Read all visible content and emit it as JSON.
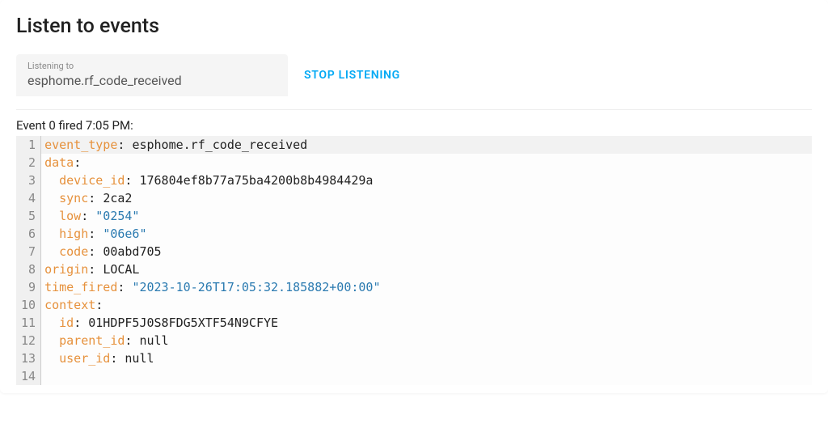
{
  "page": {
    "title": "Listen to events"
  },
  "input": {
    "label": "Listening to",
    "value": "esphome.rf_code_received"
  },
  "actions": {
    "stop": "Stop Listening"
  },
  "event_header": "Event 0 fired 7:05 PM:",
  "yaml": {
    "event_type_key": "event_type",
    "event_type_val": "esphome.rf_code_received",
    "data_key": "data",
    "device_id_key": "device_id",
    "device_id_val": "176804ef8b77a75ba4200b8b4984429a",
    "sync_key": "sync",
    "sync_val": "2ca2",
    "low_key": "low",
    "low_val": "\"0254\"",
    "high_key": "high",
    "high_val": "\"06e6\"",
    "code_key": "code",
    "code_val": "00abd705",
    "origin_key": "origin",
    "origin_val": "LOCAL",
    "time_fired_key": "time_fired",
    "time_fired_val": "\"2023-10-26T17:05:32.185882+00:00\"",
    "context_key": "context",
    "id_key": "id",
    "id_val": "01HDPF5J0S8FDG5XTF54N9CFYE",
    "parent_id_key": "parent_id",
    "parent_id_val": "null",
    "user_id_key": "user_id",
    "user_id_val": "null"
  },
  "line_count": 14
}
